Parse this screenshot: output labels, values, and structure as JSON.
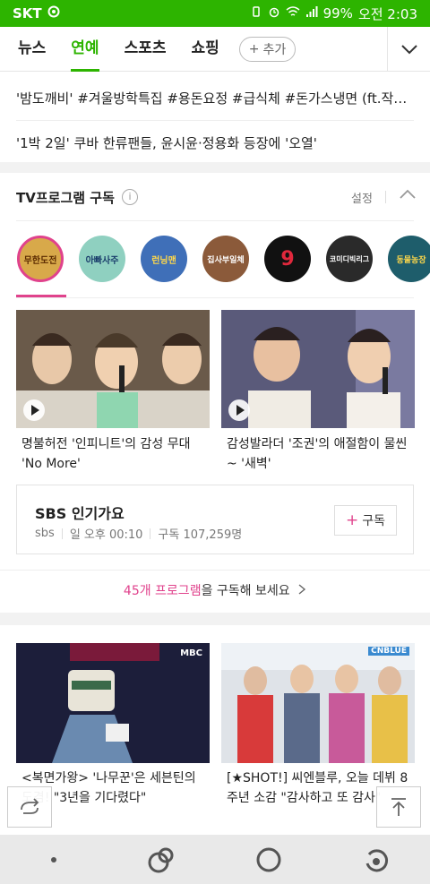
{
  "status_bar": {
    "carrier": "SKT",
    "battery": "99%",
    "time": "오전 2:03"
  },
  "tabs": {
    "items": [
      "뉴스",
      "연예",
      "스포츠",
      "쇼핑"
    ],
    "active": "연예",
    "add_label": "추가"
  },
  "headlines": [
    "'밤도깨비' #겨울방학특집 #용돈요정 #급식체 #돈가스냉면 (ft.작전...",
    "'1박 2일' 쿠바 한류팬들, 윤시윤·정용화 등장에 '오열'"
  ],
  "tv_section": {
    "title": "TV프로그램 구독",
    "info_icon": "i",
    "setting_label": "설정",
    "logos": [
      {
        "name": "무한도전",
        "color": "#d8a94a",
        "selected": true
      },
      {
        "name": "아빠사주",
        "color": "#8fd0c0"
      },
      {
        "name": "런닝맨",
        "color": "#3f6fb8"
      },
      {
        "name": "집사부일체",
        "color": "#8b5a3a"
      },
      {
        "name": "9",
        "color": "#111111"
      },
      {
        "name": "코미디빅리그",
        "color": "#2a2a2a"
      },
      {
        "name": "동물농장",
        "color": "#1e5d6b"
      }
    ],
    "videos": [
      {
        "caption_line1": "명불허전 '인피니트'의 감성 무대",
        "caption_line2": "'No More'"
      },
      {
        "caption_line1": "감성발라더 '조권'의 애절함이 물씬",
        "caption_line2": "~ '새벽'"
      }
    ],
    "program": {
      "name": "SBS 인기가요",
      "channel": "sbs",
      "schedule": "일 오후 00:10",
      "subscribers": "구독 107,259명",
      "subscribe_label": "구독"
    },
    "more_count": "45개 프로그램",
    "more_suffix": "을 구독해 보세요"
  },
  "feed": [
    {
      "caption_line1": "<복면가왕> '나무꾼'은 세븐틴의",
      "caption_line2": "도겸! \"3년을 기다렸다\"",
      "badge": "MBC"
    },
    {
      "caption_line1": "[★SHOT!] 씨엔블루, 오늘 데뷔 8",
      "caption_line2": "주년 소감 \"감사하고 또 감사\"",
      "badge": "CNBLUE"
    }
  ]
}
